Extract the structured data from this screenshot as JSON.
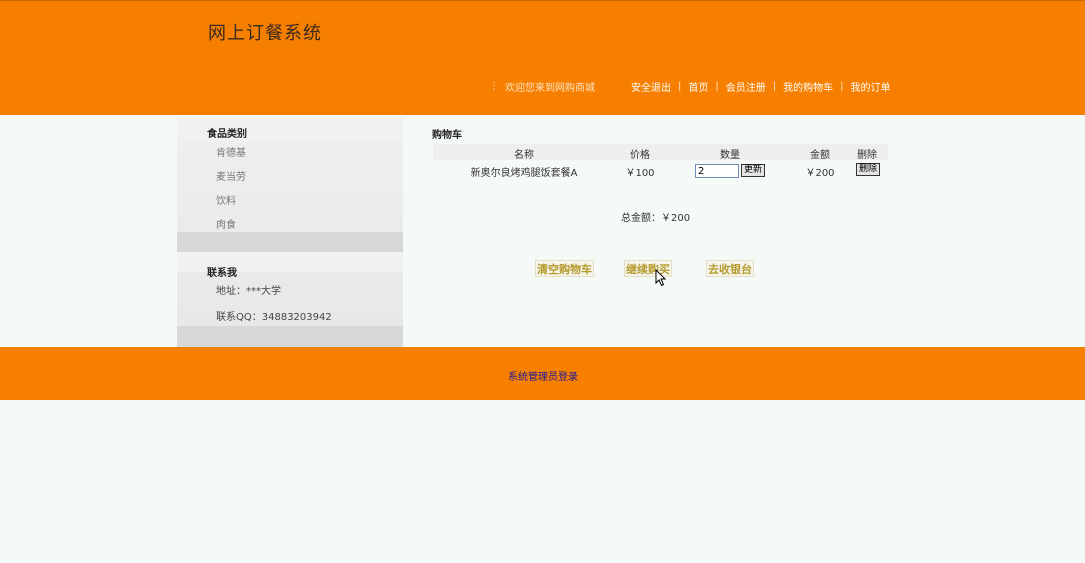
{
  "header": {
    "site_title": "网上订餐系统",
    "welcome": "欢迎您来到网购商城",
    "dots": "⋮",
    "nav": [
      {
        "label": "安全退出"
      },
      {
        "label": "首页"
      },
      {
        "label": "会员注册"
      },
      {
        "label": "我的购物车"
      },
      {
        "label": "我的订单"
      }
    ],
    "bg_color": "#f77f00"
  },
  "sidebar": {
    "category_heading": "食品类别",
    "categories": [
      "肯德基",
      "麦当劳",
      "饮料",
      "肉食"
    ],
    "contact_heading": "联系我",
    "address": "地址：***大学",
    "qq": "联系QQ：34883203942"
  },
  "cart": {
    "title": "购物车",
    "columns": [
      "名称",
      "价格",
      "数量",
      "金额",
      "删除"
    ],
    "rows": [
      {
        "name": "新奥尔良烤鸡腿饭套餐A",
        "price": "￥100",
        "quantity": "2",
        "update_label": "更新",
        "amount": "￥200",
        "delete_label": "删除"
      }
    ],
    "total": "总金额：￥200",
    "actions": {
      "clear": "清空购物车",
      "continue": "继续购买",
      "checkout": "去收银台"
    }
  },
  "footer": {
    "admin_login": "系统管理员登录"
  }
}
